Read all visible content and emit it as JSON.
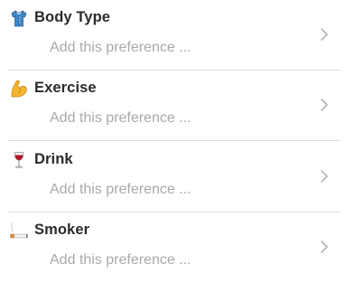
{
  "preferences": [
    {
      "title": "Body Type",
      "placeholder": "Add this preference ...",
      "icon": "shirt-icon"
    },
    {
      "title": "Exercise",
      "placeholder": "Add this preference ...",
      "icon": "flexed-biceps-icon"
    },
    {
      "title": "Drink",
      "placeholder": "Add this preference ...",
      "icon": "wine-glass-icon"
    },
    {
      "title": "Smoker",
      "placeholder": "Add this preference ...",
      "icon": "cigarette-icon"
    }
  ],
  "colors": {
    "title": "#2b2b2b",
    "placeholder": "#a9a9a9",
    "divider": "#dcdcdc",
    "chevron": "#b5b5b5"
  }
}
